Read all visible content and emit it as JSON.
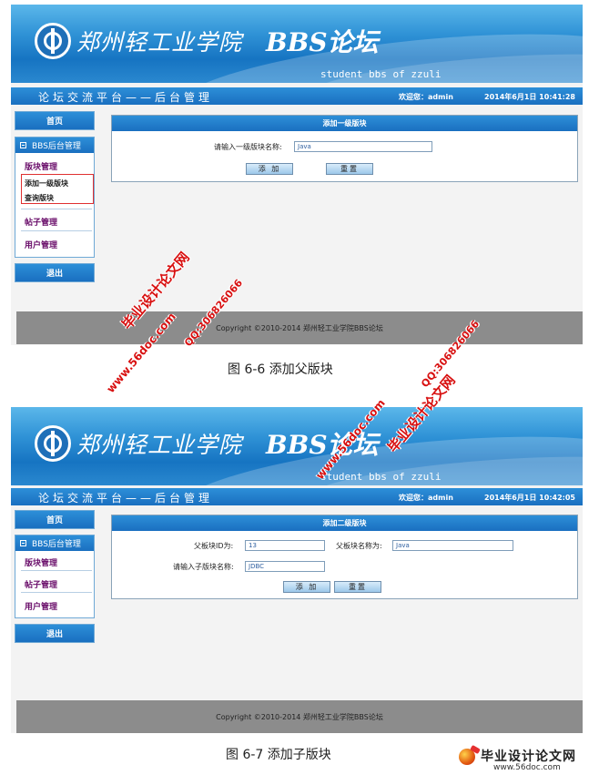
{
  "screen1": {
    "header": {
      "school_name": "郑州轻工业学院",
      "bbs_title": "BBS论坛",
      "bbs_subtitle": "student bbs of zzuli"
    },
    "navbar": {
      "system_name": "论坛交流平台——后台管理",
      "welcome": "欢迎您：admin",
      "datetime": "2014年6月1日  10:41:28"
    },
    "sidebar": {
      "home_label": "首页",
      "panel_title": "BBS后台管理",
      "section_board": "版块管理",
      "sub_add_parent": "添加一级版块",
      "sub_query": "查询版块",
      "section_posts": "帖子管理",
      "section_users": "用户管理",
      "logout_label": "退出"
    },
    "form": {
      "title": "添加一级版块",
      "field_label": "请输入一级版块名称:",
      "field_value": "Java",
      "submit_label": "添 加",
      "reset_label": "重置"
    },
    "footer": "Copyright ©2010-2014  郑州轻工业学院BBS论坛"
  },
  "caption1": "图 6-6  添加父版块",
  "screen2": {
    "header": {
      "school_name": "郑州轻工业学院",
      "bbs_title": "BBS论坛",
      "bbs_subtitle": "student bbs of zzuli"
    },
    "navbar": {
      "system_name": "论坛交流平台——后台管理",
      "welcome": "欢迎您：admin",
      "datetime": "2014年6月1日  10:42:05"
    },
    "sidebar": {
      "home_label": "首页",
      "panel_title": "BBS后台管理",
      "section_board": "版块管理",
      "section_posts": "帖子管理",
      "section_users": "用户管理",
      "logout_label": "退出"
    },
    "form": {
      "title": "添加二级版块",
      "parent_id_label": "父板块ID为:",
      "parent_id_value": "13",
      "parent_name_label": "父板块名称为:",
      "parent_name_value": "Java",
      "child_label": "请输入子版块名称:",
      "child_value": "JDBC",
      "submit_label": "添 加",
      "reset_label": "重置"
    },
    "footer": "Copyright ©2010-2014  郑州轻工业学院BBS论坛"
  },
  "caption2": "图 6-7  添加子版块",
  "watermarks": {
    "site": "毕业设计论文网",
    "url": "www.56doc.com",
    "qq": "QQ:306826066"
  },
  "brand": {
    "name": "毕业设计论文网",
    "url": "www.56doc.com"
  }
}
